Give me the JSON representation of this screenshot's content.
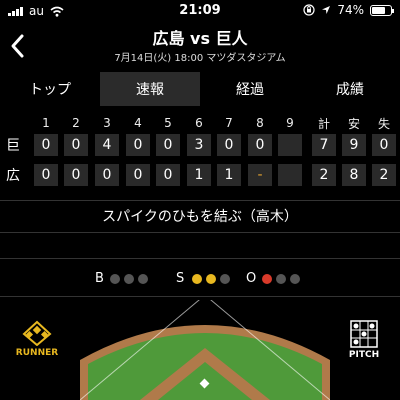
{
  "status_bar": {
    "carrier": "au",
    "time": "21:09",
    "battery": "74%",
    "battery_level": 0.74
  },
  "header": {
    "title": "広島 vs 巨人",
    "subtitle": "7月14日(火) 18:00 マツダスタジアム"
  },
  "tabs": [
    {
      "label": "トップ",
      "active": false
    },
    {
      "label": "速報",
      "active": true
    },
    {
      "label": "経過",
      "active": false
    },
    {
      "label": "成績",
      "active": false
    }
  ],
  "scoreboard": {
    "innings": [
      "1",
      "2",
      "3",
      "4",
      "5",
      "6",
      "7",
      "8",
      "9"
    ],
    "totals_headers": [
      "計",
      "安",
      "失"
    ],
    "teams": [
      {
        "name": "巨",
        "innings": [
          "0",
          "0",
          "4",
          "0",
          "0",
          "3",
          "0",
          "0",
          ""
        ],
        "totals": [
          "7",
          "9",
          "0"
        ]
      },
      {
        "name": "広",
        "innings": [
          "0",
          "0",
          "0",
          "0",
          "0",
          "1",
          "1",
          "-",
          ""
        ],
        "totals": [
          "2",
          "8",
          "2"
        ]
      }
    ]
  },
  "play_text": "スパイクのひもを結ぶ（高木）",
  "count": {
    "ball_label": "B",
    "strike_label": "S",
    "out_label": "O",
    "balls": 0,
    "strikes": 2,
    "outs": 1,
    "colors": {
      "ball": "#3fae4a",
      "strike": "#e8b820",
      "out": "#d93a2a",
      "off": "#555555"
    }
  },
  "bottom": {
    "runner_label": "RUNNER",
    "runner_icon": "diamond-icon",
    "pitch_label": "PITCH",
    "pitch_icon": "strike-zone-icon"
  },
  "colors": {
    "accent": "#e8b820",
    "field_grass": "#4f9a3a",
    "field_dirt": "#b07a4a"
  }
}
